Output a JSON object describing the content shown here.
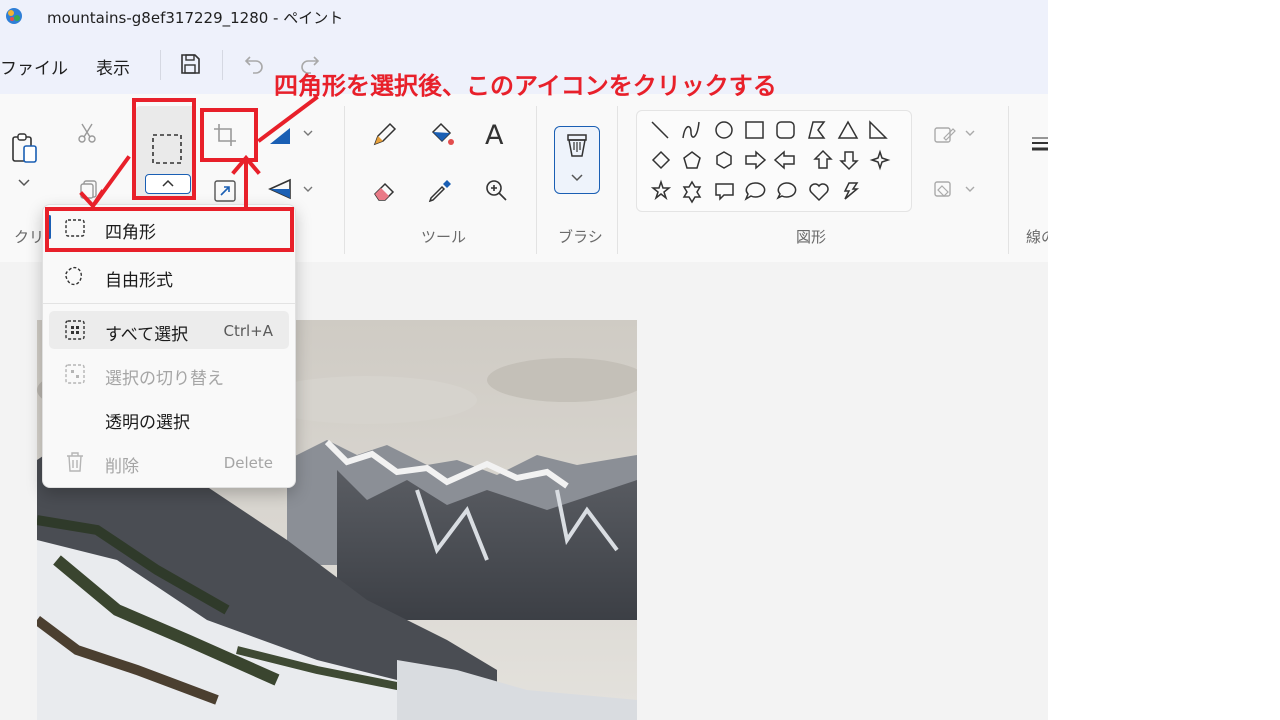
{
  "window": {
    "title": "mountains-g8ef317229_1280 - ペイント"
  },
  "menubar": {
    "file_label": "ファイル",
    "view_label": "表示"
  },
  "ribbon": {
    "groups": {
      "clipboard_label": "クリ",
      "tools_label": "ツール",
      "brush_label": "ブラシ",
      "shapes_label": "図形",
      "line_label": "線の"
    },
    "text_tool_label": "A"
  },
  "selection_menu": {
    "items": [
      {
        "label": "四角形",
        "shortcut": ""
      },
      {
        "label": "自由形式",
        "shortcut": ""
      },
      {
        "label": "すべて選択",
        "shortcut": "Ctrl+A"
      },
      {
        "label": "選択の切り替え",
        "shortcut": ""
      },
      {
        "label": "透明の選択",
        "shortcut": ""
      },
      {
        "label": "削除",
        "shortcut": "Delete"
      }
    ]
  },
  "annotation": {
    "text": "四角形を選択後、このアイコンをクリックする",
    "color": "#e8202a"
  },
  "colors": {
    "accent": "#1a5fb4",
    "annotation_red": "#e8202a",
    "titlebar_bg": "#eef1fb"
  },
  "icons": {
    "app": "paint-app-icon",
    "save": "save-icon",
    "undo": "undo-icon",
    "redo": "redo-icon",
    "paste": "paste-icon",
    "cut": "cut-icon",
    "copy": "copy-icon",
    "select": "rectangle-select-icon",
    "crop": "crop-icon",
    "resize": "resize-icon",
    "pencil": "pencil-icon",
    "fill": "fill-bucket-icon",
    "text": "text-icon",
    "eraser": "eraser-icon",
    "picker": "color-picker-icon",
    "zoom": "magnifier-icon"
  }
}
